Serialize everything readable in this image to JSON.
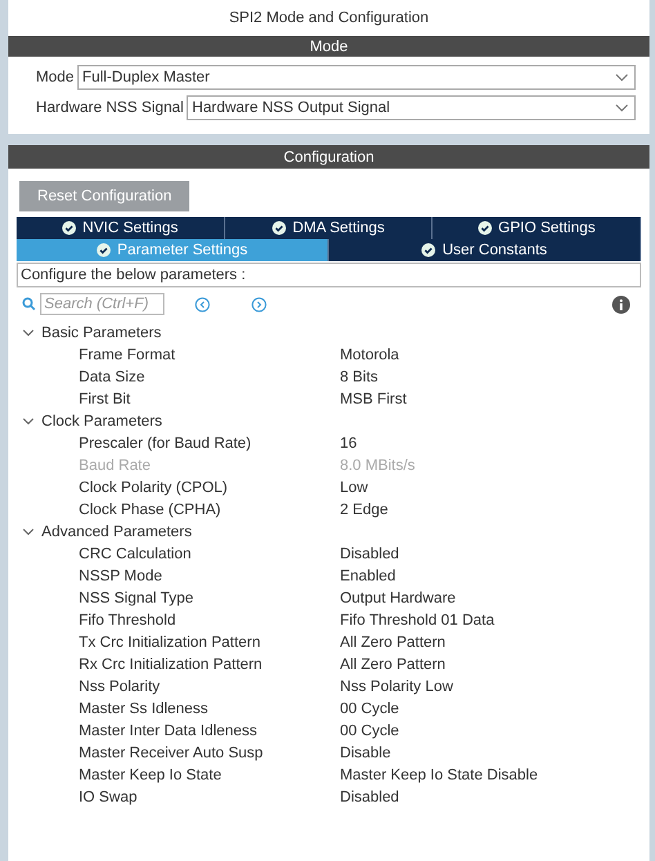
{
  "window": {
    "title": "SPI2 Mode and Configuration"
  },
  "mode_section": {
    "title": "Mode",
    "fields": [
      {
        "label": "Mode",
        "value": "Full-Duplex Master"
      },
      {
        "label": "Hardware NSS Signal",
        "value": "Hardware NSS Output Signal"
      }
    ]
  },
  "configuration_section": {
    "title": "Configuration",
    "reset_button": "Reset Configuration",
    "tab_rows": [
      [
        {
          "label": "NVIC Settings",
          "selected": false
        },
        {
          "label": "DMA Settings",
          "selected": false
        },
        {
          "label": "GPIO Settings",
          "selected": false
        }
      ],
      [
        {
          "label": "Parameter Settings",
          "selected": true
        },
        {
          "label": "User Constants",
          "selected": false
        }
      ]
    ],
    "description": "Configure the below parameters :",
    "search": {
      "placeholder": "Search (Ctrl+F)"
    },
    "groups": [
      {
        "name": "Basic Parameters",
        "expanded": true,
        "parameters": [
          {
            "name": "Frame Format",
            "value": "Motorola",
            "disabled": false
          },
          {
            "name": "Data Size",
            "value": "8 Bits",
            "disabled": false
          },
          {
            "name": "First Bit",
            "value": "MSB First",
            "disabled": false
          }
        ]
      },
      {
        "name": "Clock Parameters",
        "expanded": true,
        "parameters": [
          {
            "name": "Prescaler (for Baud Rate)",
            "value": "16",
            "disabled": false
          },
          {
            "name": "Baud Rate",
            "value": "8.0 MBits/s",
            "disabled": true
          },
          {
            "name": "Clock Polarity (CPOL)",
            "value": "Low",
            "disabled": false
          },
          {
            "name": "Clock Phase (CPHA)",
            "value": "2 Edge",
            "disabled": false
          }
        ]
      },
      {
        "name": "Advanced Parameters",
        "expanded": true,
        "parameters": [
          {
            "name": "CRC Calculation",
            "value": "Disabled",
            "disabled": false
          },
          {
            "name": "NSSP Mode",
            "value": "Enabled",
            "disabled": false
          },
          {
            "name": "NSS Signal Type",
            "value": "Output Hardware",
            "disabled": false
          },
          {
            "name": "Fifo Threshold",
            "value": "Fifo Threshold 01 Data",
            "disabled": false
          },
          {
            "name": "Tx Crc Initialization Pattern",
            "value": "All Zero Pattern",
            "disabled": false
          },
          {
            "name": "Rx Crc Initialization Pattern",
            "value": "All Zero Pattern",
            "disabled": false
          },
          {
            "name": "Nss Polarity",
            "value": "Nss Polarity Low",
            "disabled": false
          },
          {
            "name": "Master Ss Idleness",
            "value": "00 Cycle",
            "disabled": false
          },
          {
            "name": "Master Inter Data Idleness",
            "value": "00 Cycle",
            "disabled": false
          },
          {
            "name": "Master Receiver Auto Susp",
            "value": "Disable",
            "disabled": false
          },
          {
            "name": "Master Keep Io State",
            "value": "Master Keep Io State Disable",
            "disabled": false
          },
          {
            "name": "IO Swap",
            "value": "Disabled",
            "disabled": false
          }
        ]
      }
    ]
  }
}
